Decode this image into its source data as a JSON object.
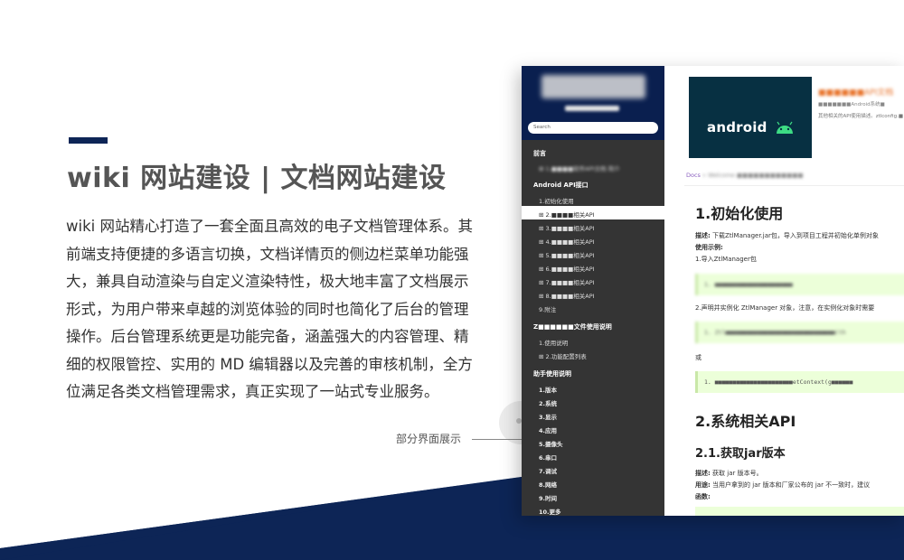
{
  "colors": {
    "navy": "#0d2556",
    "sidebar": "#343434",
    "sidebar_header": "#0a1f4f",
    "code_bg": "#ecffd9",
    "accent_orange": "#e8742c",
    "android_banner": "#073042"
  },
  "hero": {
    "title": "wiki 网站建设 | 文档网站建设",
    "description": "wiki 网站精心打造了一套全面且高效的电子文档管理体系。其前端支持便捷的多语言切换，文档详情页的侧边栏菜单功能强大，兼具自动渲染与自定义渲染特性，极大地丰富了文档展示形式，为用户带来卓越的浏览体验的同时也简化了后台的管理操作。后台管理系统更是功能完备，涵盖强大的内容管理、精细的权限管控、实用的 MD 编辑器以及完善的审核机制，全方位满足各类文档管理需求，真正实现了一站式专业服务。",
    "callout": "部分界面展示"
  },
  "sidebar": {
    "search_placeholder": "Search",
    "sections": [
      {
        "label": "前言",
        "items": [
          {
            "label": "⊞ 1.■■■■软件API文档 简介"
          }
        ]
      },
      {
        "label": "Android API接口",
        "items": [
          {
            "label": "1.初始化使用"
          },
          {
            "label": "⊞ 2.■■■■相关API",
            "active": true
          },
          {
            "label": "⊞ 3.■■■■相关API"
          },
          {
            "label": "⊞ 4.■■■■相关API"
          },
          {
            "label": "⊞ 5.■■■■相关API"
          },
          {
            "label": "⊞ 6.■■■■相关API"
          },
          {
            "label": "⊞ 7.■■■■相关API"
          },
          {
            "label": "⊞ 8.■■■■相关API"
          },
          {
            "label": "9.附注"
          }
        ]
      },
      {
        "label": "Z■■■■■■文件使用说明",
        "items": [
          {
            "label": "1.使用说明"
          },
          {
            "label": "⊞ 2.功能配置列表"
          }
        ]
      },
      {
        "label": "助手使用说明",
        "items": [
          {
            "label": "1.版本"
          },
          {
            "label": "2.系统"
          },
          {
            "label": "3.显示"
          },
          {
            "label": "4.应用"
          },
          {
            "label": "5.摄像头"
          },
          {
            "label": "6.串口"
          },
          {
            "label": "7.调试"
          },
          {
            "label": "8.网络"
          },
          {
            "label": "9.时间"
          },
          {
            "label": "10.更多"
          }
        ]
      }
    ]
  },
  "content": {
    "banner_word": "android",
    "banner_title": "■■■■■■API文档",
    "banner_sub1": "■■■■■■■Android系统■",
    "banner_sub2": "其他相关的API使用描述。ztlconfig.■",
    "breadcrumb_docs": "Docs",
    "breadcrumb_rest": "» Welcome ■■■■■■■■■■■■",
    "h1_init": "1.初始化使用",
    "desc_label": "描述:",
    "desc_text": "下载ZtlManager.jar包，导入到项目工程并初始化单例对象",
    "example_label": "使用示例:",
    "step1": "1.导入ZtlManager包",
    "code1": "1.  ■■■■■■■■■■■■■■■■■■■■■■",
    "step2": "2.声明并实例化 ZtlManager 对象，注意，在实例化对象时需要",
    "code2": "1.  Ztl■■■■■■■■■■■■■■■■■■■■■■■■■■■■■■■(th",
    "or": "或",
    "code3": "1.  ■■■■■■■■■■■■■■■■■■■■■■etContext(g■■■■■■",
    "h1_sys": "2.系统相关API",
    "h2_jar": "2.1.获取jar版本",
    "desc2_label": "描述:",
    "desc2_text": "获取 jar 版本号。",
    "usage_label": "用途:",
    "usage_text": "当用户拿到的 jar 版本和厂家公布的 jar 不一致时，建议",
    "func_label": "函数:"
  }
}
